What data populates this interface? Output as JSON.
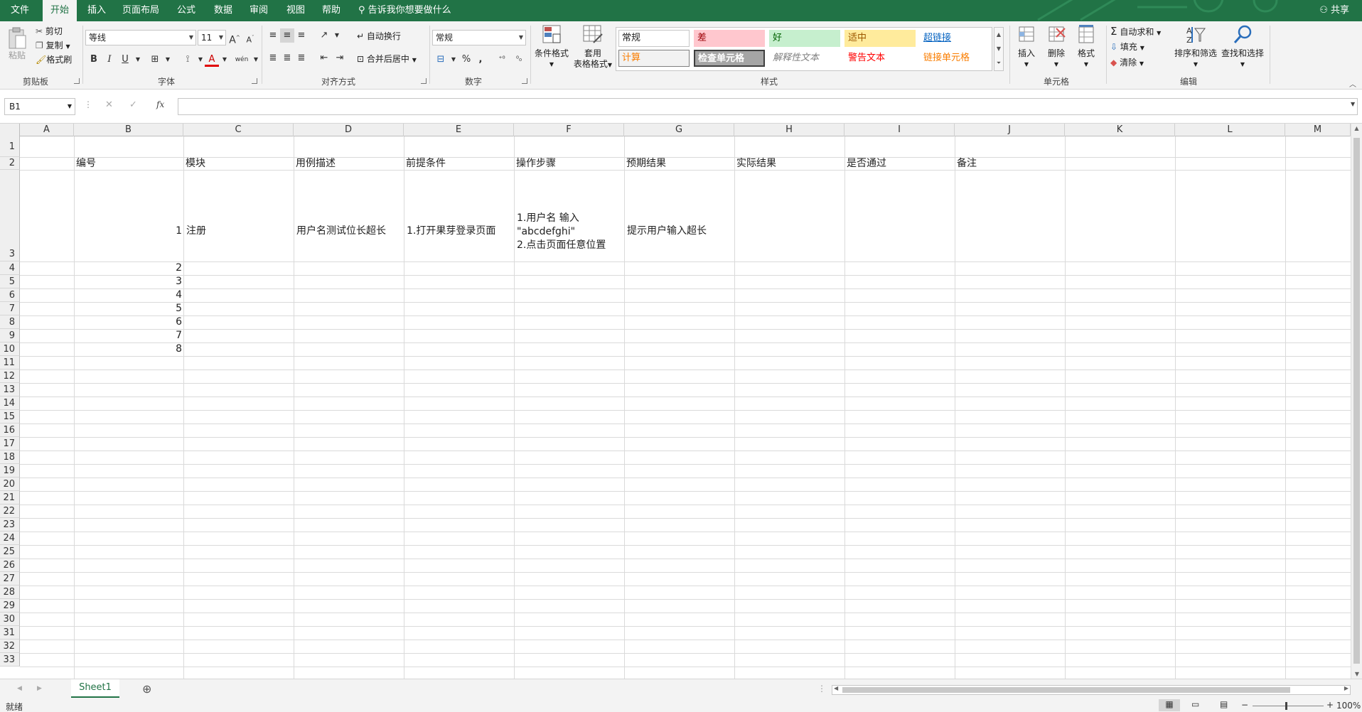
{
  "menu": {
    "tabs": [
      "文件",
      "开始",
      "插入",
      "页面布局",
      "公式",
      "数据",
      "审阅",
      "视图",
      "帮助"
    ],
    "active": "开始",
    "tell_me": "告诉我你想要做什么",
    "share": "共享"
  },
  "ribbon": {
    "clipboard": {
      "paste": "粘贴",
      "cut": "剪切",
      "copy": "复制",
      "format_painter": "格式刷",
      "label": "剪贴板"
    },
    "font": {
      "name": "等线",
      "size": "11",
      "label": "字体",
      "bold": "B",
      "italic": "I",
      "underline": "U",
      "grow": "A",
      "shrink": "A",
      "font_color": "A",
      "phonetic": "wén"
    },
    "alignment": {
      "wrap_text": "自动换行",
      "merge_center": "合并后居中",
      "label": "对齐方式"
    },
    "number": {
      "format": "常规",
      "percent": "%",
      "comma": ",",
      "label": "数字"
    },
    "styles": {
      "conditional": "条件格式",
      "format_table_1": "套用",
      "format_table_2": "表格格式",
      "cells": [
        {
          "text": "常规",
          "bg": "#ffffff",
          "color": "#222222",
          "border": "#c6c6c6"
        },
        {
          "text": "差",
          "bg": "#ffc7ce",
          "color": "#9c0006",
          "border": "#ffc7ce"
        },
        {
          "text": "好",
          "bg": "#c6efce",
          "color": "#006100",
          "border": "#c6efce"
        },
        {
          "text": "适中",
          "bg": "#ffeb9c",
          "color": "#9c5700",
          "border": "#ffeb9c"
        },
        {
          "text": "超链接",
          "bg": "#ffffff",
          "color": "#0563c1",
          "border": "#ffffff"
        },
        {
          "text": "计算",
          "bg": "#f2f2f2",
          "color": "#fa7d00",
          "border": "#7f7f7f"
        },
        {
          "text": "检查单元格",
          "bg": "#a5a5a5",
          "color": "#ffffff",
          "border": "#3f3f3f"
        },
        {
          "text": "解释性文本",
          "bg": "#ffffff",
          "color": "#7f7f7f",
          "border": "#ffffff"
        },
        {
          "text": "警告文本",
          "bg": "#ffffff",
          "color": "#ff0000",
          "border": "#ffffff"
        },
        {
          "text": "链接单元格",
          "bg": "#ffffff",
          "color": "#fa7d00",
          "border": "#ffffff"
        }
      ],
      "label": "样式"
    },
    "cells": {
      "insert": "插入",
      "delete": "删除",
      "format": "格式",
      "label": "单元格"
    },
    "editing": {
      "autosum": "自动求和",
      "fill": "填充",
      "clear": "清除",
      "sort_filter": "排序和筛选",
      "find_select": "查找和选择",
      "label": "编辑"
    }
  },
  "formula_bar": {
    "name_box": "B1",
    "fx": "fx",
    "value": ""
  },
  "sheet": {
    "columns": [
      "A",
      "B",
      "C",
      "D",
      "E",
      "F",
      "G",
      "H",
      "I",
      "J",
      "K",
      "L",
      "M"
    ],
    "row_numbers": [
      "1",
      "2",
      "3",
      "4",
      "5",
      "6",
      "7",
      "8",
      "9",
      "10",
      "11",
      "12",
      "13",
      "14",
      "15",
      "16",
      "17",
      "18",
      "19",
      "20",
      "21",
      "22",
      "23",
      "24",
      "25",
      "26",
      "27",
      "28",
      "29",
      "30",
      "31",
      "32",
      "33"
    ],
    "headers": [
      "编号",
      "模块",
      "用例描述",
      "前提条件",
      "操作步骤",
      "预期结果",
      "实际结果",
      "是否通过",
      "备注"
    ],
    "row3": {
      "id": "1",
      "module": "注册",
      "desc": "用户名测试位长超长",
      "precondition": "1.打开果芽登录页面",
      "steps_1": "1.用户名 输入",
      "steps_2": "\"abcdefghi\"",
      "steps_3": "2.点击页面任意位置",
      "expected": "提示用户输入超长"
    },
    "ids": [
      "2",
      "3",
      "4",
      "5",
      "6",
      "7",
      "8"
    ]
  },
  "sheet_tabs": {
    "active": "Sheet1",
    "add": "⊕"
  },
  "status": {
    "ready": "就绪",
    "zoom": "100%"
  }
}
